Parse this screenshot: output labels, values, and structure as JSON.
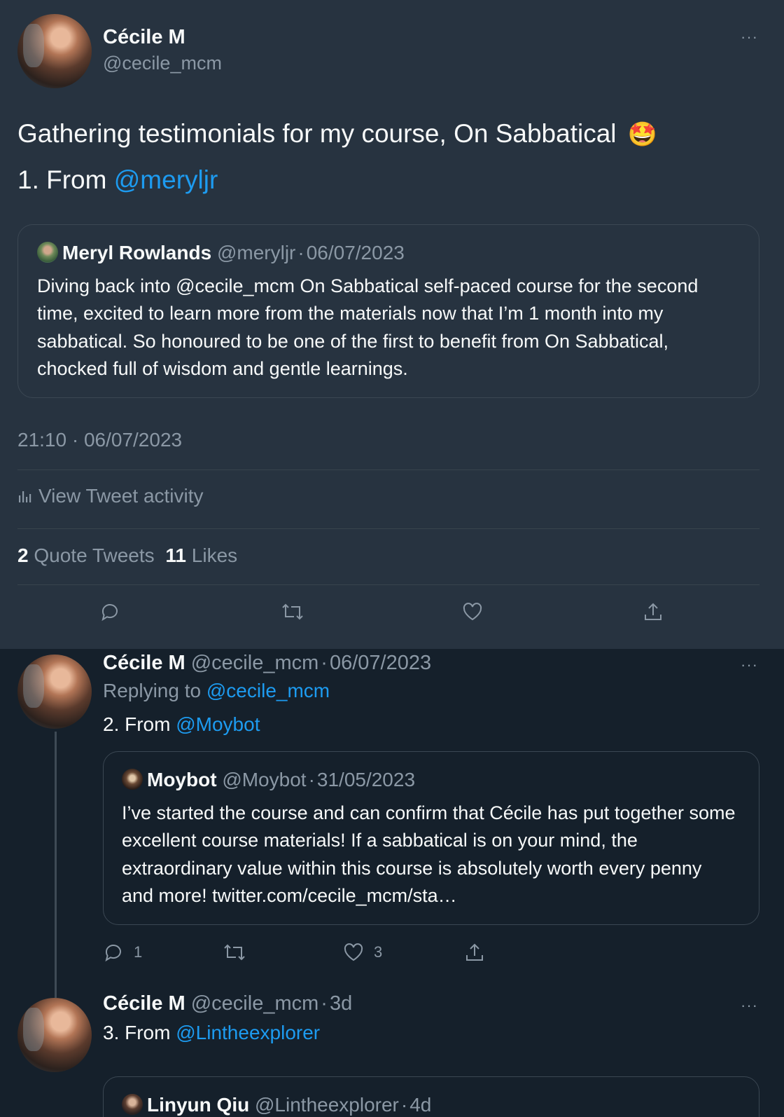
{
  "main_tweet": {
    "author_name": "Cécile M",
    "author_handle": "@cecile_mcm",
    "text_line1": "Gathering testimonials for my course, On Sabbatical",
    "emoji": "🤩",
    "text_line2_prefix": "1. From ",
    "text_line2_mention": "@meryljr",
    "quote": {
      "author_name": "Meryl Rowlands",
      "author_handle": "@meryljr",
      "sep": "·",
      "date": "06/07/2023",
      "text": "Diving back into @cecile_mcm On Sabbatical self-paced course for the second time, excited to learn more from the materials now that I’m 1 month into my sabbatical. So honoured to be one of the first to benefit from On Sabbatical, chocked full of wisdom and gentle learnings."
    },
    "timestamp": "21:10 · 06/07/2023",
    "activity_label": "View Tweet activity",
    "quote_tweets_count": "2",
    "quote_tweets_label": "Quote Tweets",
    "likes_count": "11",
    "likes_label": "Likes",
    "more": "···"
  },
  "replies": [
    {
      "author_name": "Cécile M",
      "author_handle": "@cecile_mcm",
      "sep": "·",
      "date": "06/07/2023",
      "replying_label": "Replying to ",
      "replying_to": "@cecile_mcm",
      "text_prefix": "2. From ",
      "text_mention": "@Moybot",
      "quote": {
        "author_name": "Moybot",
        "author_handle": "@Moybot",
        "sep": "·",
        "date": "31/05/2023",
        "text": "I’ve started the course and can confirm that Cécile has put together some excellent course materials! If a sabbatical is on your mind, the extraordinary value within this course is absolutely worth every penny and more! twitter.com/cecile_mcm/sta…"
      },
      "reply_count": "1",
      "like_count": "3",
      "more": "···"
    },
    {
      "author_name": "Cécile M",
      "author_handle": "@cecile_mcm",
      "sep": "·",
      "date": "3d",
      "text_prefix": "3. From ",
      "text_mention": "@Lintheexplorer",
      "quote": {
        "author_name": "Linyun Qiu",
        "author_handle": "@Lintheexplorer",
        "sep": "·",
        "date": "4d"
      },
      "more": "···"
    }
  ]
}
